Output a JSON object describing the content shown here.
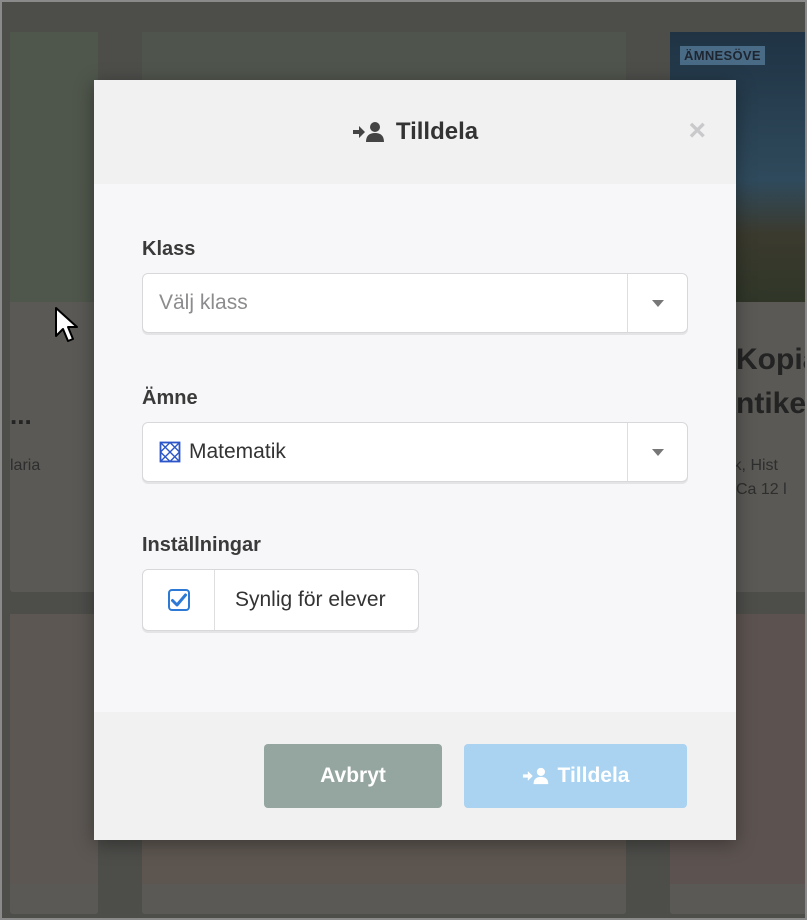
{
  "background": {
    "tag": "ÄMNESÖVE",
    "title_line1": "Kopia",
    "title_line2": "ntike",
    "sub_line1": "sik, Hist",
    "sub_line2": "Ca 12 l",
    "left_dots": "...",
    "left_sub": "laria"
  },
  "modal": {
    "title": "Tilldela",
    "close_label": "×",
    "class_field": {
      "label": "Klass",
      "placeholder": "Välj klass"
    },
    "subject_field": {
      "label": "Ämne",
      "value": "Matematik",
      "icon": "math-subject-icon"
    },
    "settings": {
      "label": "Inställningar",
      "visible_to_students": {
        "label": "Synlig för elever",
        "checked": true
      }
    },
    "buttons": {
      "cancel": "Avbryt",
      "assign": "Tilldela"
    }
  },
  "colors": {
    "assign_button": "#a9d3f0",
    "cancel_button": "#95a5a0",
    "checkbox": "#2d7ad6",
    "math_icon": "#2b55c8"
  }
}
